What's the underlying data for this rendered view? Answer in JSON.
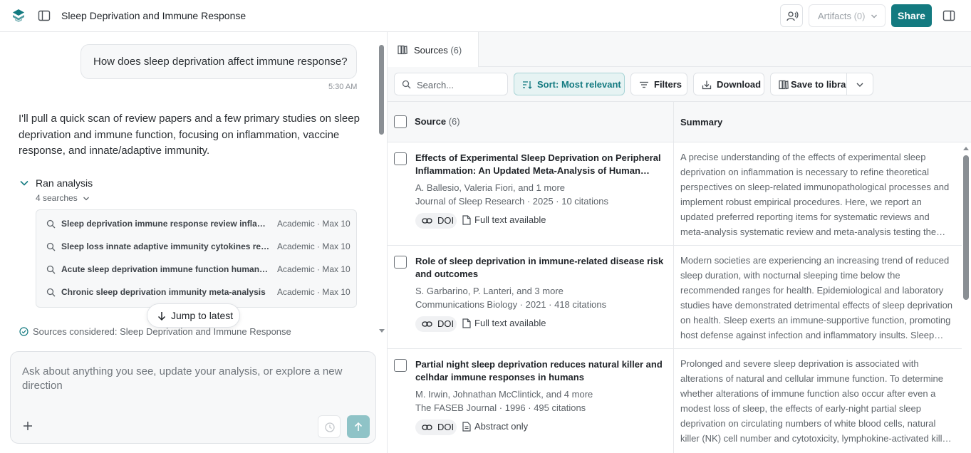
{
  "header": {
    "title": "Sleep Deprivation and Immune Response",
    "artifacts_label": "Artifacts",
    "artifacts_count": "(0)",
    "share_label": "Share"
  },
  "chat": {
    "user_message": "How does sleep deprivation affect immune response?",
    "user_time": "5:30 AM",
    "assistant_message": "I'll pull a quick scan of review papers and a few primary studies on sleep deprivation and immune function, focusing on inflammation, vaccine response, and innate/adaptive immunity.",
    "analysis_label": "Ran analysis",
    "searches_count": "4 searches",
    "searches": [
      {
        "query": "Sleep deprivation immune response review inflammation",
        "meta": "Academic · Max 10"
      },
      {
        "query": "Sleep loss innate adaptive immunity cytokines review",
        "meta": "Academic · Max 10"
      },
      {
        "query": "Acute sleep deprivation immune function humans study",
        "meta": "Academic · Max 10"
      },
      {
        "query": "Chronic sleep deprivation immunity meta-analysis",
        "meta": "Academic · Max 10"
      }
    ],
    "jump_label": "Jump to latest",
    "sources_considered": "Sources considered: Sleep Deprivation and Immune Response",
    "composer_placeholder": "Ask about anything you see, update your analysis, or explore a new direction"
  },
  "panel": {
    "tab_label": "Sources",
    "tab_count": "(6)",
    "search_placeholder": "Search...",
    "sort_label": "Sort: Most relevant",
    "filters_label": "Filters",
    "download_label": "Download",
    "save_label": "Save to library",
    "col_source": "Source",
    "col_source_count": "(6)",
    "col_summary": "Summary"
  },
  "sources": [
    {
      "title": "Effects of Experimental Sleep Deprivation on Peripheral Inflammation: An Updated Meta-Analysis of Human Studies",
      "authors": "A. Ballesio, Valeria Fiori, and 1 more",
      "venue": "Journal of Sleep Research · 2025 · 10 citations",
      "doi": "DOI",
      "availability": "Full text available",
      "summary": "A precise understanding of the effects of experimental sleep deprivation on inflammation is necessary to refine theoretical perspectives on sleep-related immunopathological processes and implement robust empirical procedures. Here, we report an updated preferred reporting items for systematic reviews and meta-analysis systematic review and meta-analysis testing the effects of experimental sleep deprivation."
    },
    {
      "title": "Role of sleep deprivation in immune-related disease risk and outcomes",
      "authors": "S. Garbarino, P. Lanteri, and 3 more",
      "venue": "Communications Biology · 2021 · 418 citations",
      "doi": "DOI",
      "availability": "Full text available",
      "summary": "Modern societies are experiencing an increasing trend of reduced sleep duration, with nocturnal sleeping time below the recommended ranges for health. Epidemiological and laboratory studies have demonstrated detrimental effects of sleep deprivation on health. Sleep exerts an immune-supportive function, promoting host defense against infection and inflammatory insults. Sleep deprivation has been associated with alterations of innate and adaptive immune parameters."
    },
    {
      "title": "Partial night sleep deprivation reduces natural killer and celhdar immune responses in humans",
      "authors": "M. Irwin, Johnathan McClintick, and 4 more",
      "venue": "The FASEB Journal · 1996 · 495 citations",
      "doi": "DOI",
      "availability": "Abstract only",
      "summary": "Prolonged and severe sleep deprivation is associated with alterations of natural and cellular immune function. To determine whether alterations of immune function also occur after even a modest loss of sleep, the effects of early-night partial sleep deprivation on circulating numbers of white blood cells, natural killer (NK) cell number and cytotoxicity, lymphokine-activated killer cell activity were evaluated."
    }
  ],
  "colors": {
    "accent": "#137a80",
    "accent_soft": "#e6f3f3",
    "send_disabled": "#8fc3c7"
  },
  "icons": [
    "logo-icon",
    "sidebar-toggle-icon",
    "voice-icon",
    "chevron-down-icon",
    "panel-toggle-icon",
    "search-icon",
    "arrow-down-icon",
    "check-circle-icon",
    "plus-icon",
    "history-icon",
    "arrow-up-icon",
    "sources-icon",
    "sort-icon",
    "filter-icon",
    "download-icon",
    "library-icon",
    "link-icon",
    "document-icon"
  ]
}
